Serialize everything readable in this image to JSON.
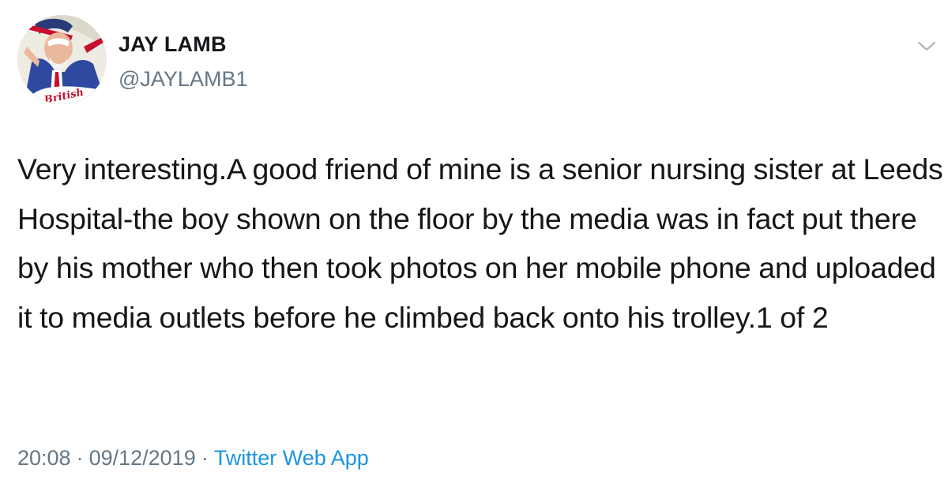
{
  "tweet": {
    "author": {
      "display_name": "JAY LAMB",
      "handle": "@JAYLAMB1",
      "avatar_text": "British"
    },
    "text": "Very interesting.A good friend of mine is a senior nursing sister at Leeds Hospital-the boy shown on the floor by the media was in fact put there by his mother who then took photos on her mobile phone and uploaded it to media outlets before he climbed back onto his trolley.1 of 2",
    "time": "20:08",
    "date": "09/12/2019",
    "separator": "·",
    "source": "Twitter Web App"
  },
  "icons": {
    "menu": "chevron-down-icon"
  },
  "colors": {
    "text": "#14171a",
    "secondary": "#657786",
    "link": "#1b95e0"
  }
}
